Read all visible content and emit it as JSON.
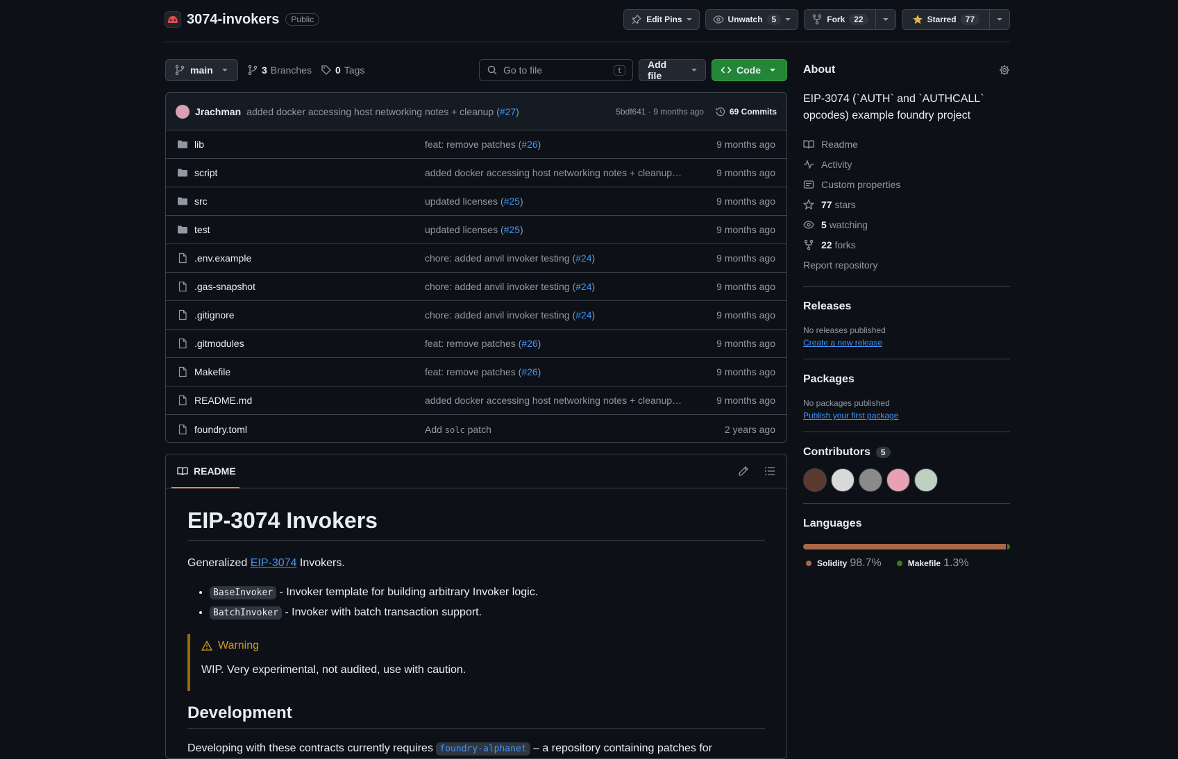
{
  "repo": {
    "name": "3074-invokers",
    "visibility": "Public"
  },
  "actions": {
    "edit_pins": "Edit Pins",
    "unwatch": "Unwatch",
    "watch_count": "5",
    "fork": "Fork",
    "fork_count": "22",
    "starred": "Starred",
    "star_count": "77"
  },
  "toolbar": {
    "branch": "main",
    "branches_count": "3",
    "branches_label": "Branches",
    "tags_count": "0",
    "tags_label": "Tags",
    "goto_placeholder": "Go to file",
    "goto_key": "t",
    "add_file": "Add file",
    "code": "Code"
  },
  "commit": {
    "author": "Jrachman",
    "message": "added docker accessing host networking notes + cleanup (",
    "pr": "#27",
    "message_end": ")",
    "meta": "5bdf641 · 9 months ago",
    "count": "69 Commits"
  },
  "files": [
    {
      "type": "dir",
      "name": "lib",
      "msg": "feat: remove patches (",
      "pr": "#26",
      "end": ")",
      "age": "9 months ago"
    },
    {
      "type": "dir",
      "name": "script",
      "msg": "added docker accessing host networking notes + cleanup…",
      "pr": "",
      "end": "",
      "age": "9 months ago"
    },
    {
      "type": "dir",
      "name": "src",
      "msg": "updated licenses (",
      "pr": "#25",
      "end": ")",
      "age": "9 months ago"
    },
    {
      "type": "dir",
      "name": "test",
      "msg": "updated licenses (",
      "pr": "#25",
      "end": ")",
      "age": "9 months ago"
    },
    {
      "type": "file",
      "name": ".env.example",
      "msg": "chore: added anvil invoker testing (",
      "pr": "#24",
      "end": ")",
      "age": "9 months ago"
    },
    {
      "type": "file",
      "name": ".gas-snapshot",
      "msg": "chore: added anvil invoker testing (",
      "pr": "#24",
      "end": ")",
      "age": "9 months ago"
    },
    {
      "type": "file",
      "name": ".gitignore",
      "msg": "chore: added anvil invoker testing (",
      "pr": "#24",
      "end": ")",
      "age": "9 months ago"
    },
    {
      "type": "file",
      "name": ".gitmodules",
      "msg": "feat: remove patches (",
      "pr": "#26",
      "end": ")",
      "age": "9 months ago"
    },
    {
      "type": "file",
      "name": "Makefile",
      "msg": "feat: remove patches (",
      "pr": "#26",
      "end": ")",
      "age": "9 months ago"
    },
    {
      "type": "file",
      "name": "README.md",
      "msg": "added docker accessing host networking notes + cleanup…",
      "pr": "",
      "end": "",
      "age": "9 months ago"
    },
    {
      "type": "file",
      "name": "foundry.toml",
      "msg": "Add ",
      "code": "solc",
      "msg_end": " patch",
      "pr": "",
      "end": "",
      "age": "2 years ago"
    }
  ],
  "readme": {
    "tab": "README",
    "title": "EIP-3074 Invokers",
    "intro_pre": "Generalized ",
    "intro_link": "EIP-3074",
    "intro_post": " Invokers.",
    "bullets": [
      {
        "code": "BaseInvoker",
        "text": " - Invoker template for building arbitrary Invoker logic."
      },
      {
        "code": "BatchInvoker",
        "text": " - Invoker with batch transaction support."
      }
    ],
    "warning_title": "Warning",
    "warning_text": "WIP. Very experimental, not audited, use with caution.",
    "dev_title": "Development",
    "dev_pre": "Developing with these contracts currently requires ",
    "dev_code": "foundry-alphanet",
    "dev_post": " – a repository containing patches for"
  },
  "about": {
    "title": "About",
    "desc": "EIP-3074 (`AUTH` and `AUTHCALL` opcodes) example foundry project",
    "readme": "Readme",
    "activity": "Activity",
    "custom": "Custom properties",
    "stars_n": "77",
    "stars": "stars",
    "watching_n": "5",
    "watching": "watching",
    "forks_n": "22",
    "forks": "forks",
    "report": "Report repository"
  },
  "releases": {
    "title": "Releases",
    "none": "No releases published",
    "create": "Create a new release"
  },
  "packages": {
    "title": "Packages",
    "none": "No packages published",
    "publish": "Publish your first package"
  },
  "contributors": {
    "title": "Contributors",
    "count": "5"
  },
  "languages": {
    "title": "Languages",
    "items": [
      {
        "name": "Solidity",
        "pct": "98.7%",
        "value": 98.7,
        "color": "#AA6746"
      },
      {
        "name": "Makefile",
        "pct": "1.3%",
        "value": 1.3,
        "color": "#427819"
      }
    ]
  }
}
